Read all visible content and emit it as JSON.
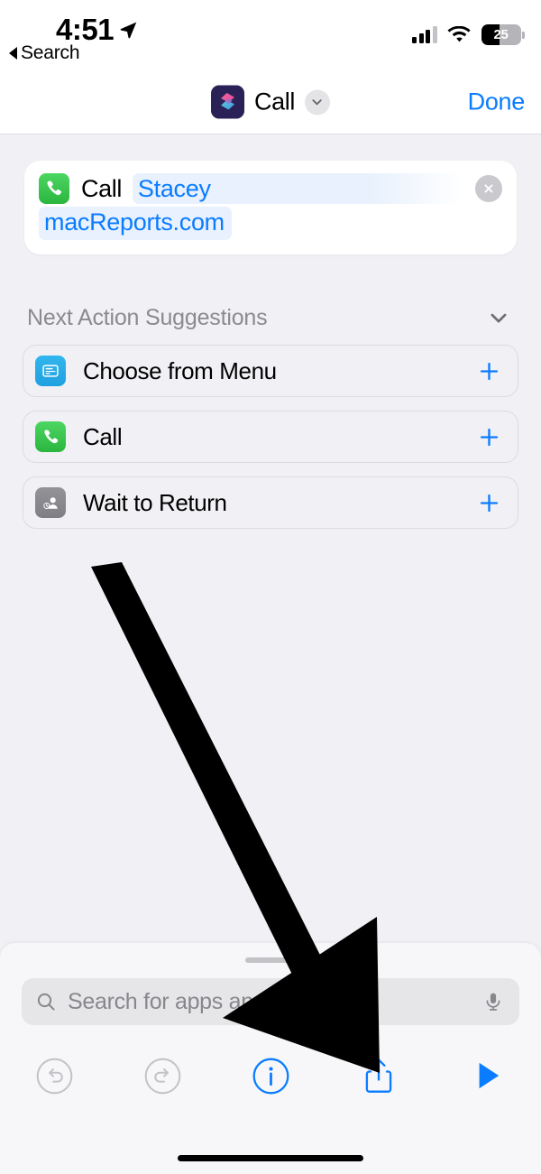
{
  "status_bar": {
    "time": "4:51",
    "location_icon": "location-arrow-icon",
    "back_label": "Search",
    "cellular_icon": "cellular-signal-icon",
    "wifi_icon": "wifi-icon",
    "battery_percent": "25",
    "battery_icon": "battery-icon"
  },
  "nav_bar": {
    "app_icon": "shortcuts-app-icon",
    "title": "Call",
    "chevron_icon": "chevron-down-icon",
    "done_label": "Done"
  },
  "action_card": {
    "app_icon": "phone-app-icon",
    "verb": "Call",
    "contact_name": "Stacey",
    "contact_domain": "macReports.com",
    "clear_icon": "close-circle-icon"
  },
  "suggestions": {
    "header": "Next Action Suggestions",
    "collapse_icon": "chevron-down-icon",
    "items": [
      {
        "label": "Choose from Menu",
        "icon": "menu-card-icon",
        "icon_color": "#2aace7",
        "add_icon": "plus-icon"
      },
      {
        "label": "Call",
        "icon": "phone-icon",
        "icon_color": "#35c759",
        "add_icon": "plus-icon"
      },
      {
        "label": "Wait to Return",
        "icon": "person-clock-icon",
        "icon_color": "#8a8a8f",
        "add_icon": "plus-icon"
      }
    ]
  },
  "sheet": {
    "grabber": "sheet-grabber",
    "search_placeholder": "Search for apps and actions",
    "search_value": "",
    "search_icon": "search-icon",
    "mic_icon": "microphone-icon"
  },
  "toolbar": {
    "buttons": [
      {
        "name": "undo-button",
        "icon": "undo-icon",
        "enabled": false
      },
      {
        "name": "redo-button",
        "icon": "redo-icon",
        "enabled": false
      },
      {
        "name": "info-button",
        "icon": "info-circle-icon",
        "enabled": true
      },
      {
        "name": "share-button",
        "icon": "share-icon",
        "enabled": true
      },
      {
        "name": "play-button",
        "icon": "play-icon",
        "enabled": true
      }
    ]
  },
  "annotation": {
    "arrow": "pointer-arrow-to-share-button",
    "color": "#000000"
  },
  "colors": {
    "accent_blue": "#0a7cff",
    "page_background": "#f1f1f5",
    "card_background": "#ffffff",
    "token_highlight": "#e8f1fd",
    "muted_text": "#8a8a8f"
  }
}
